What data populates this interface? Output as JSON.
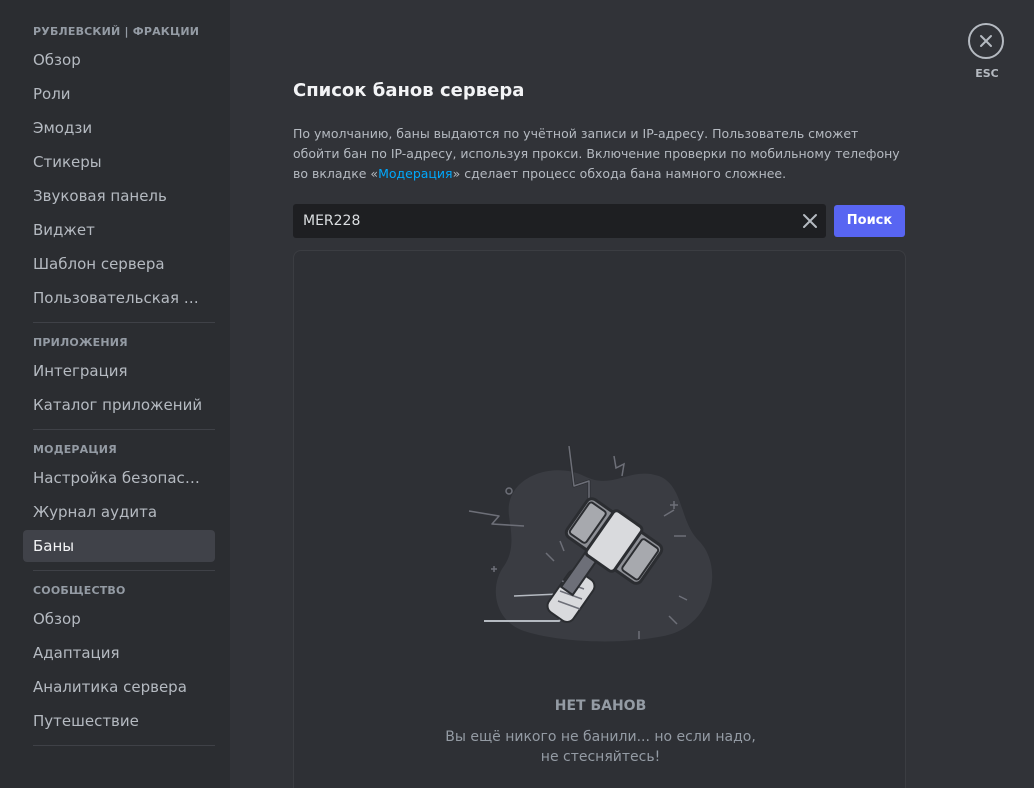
{
  "sidebar": {
    "sections": [
      {
        "title": "РУБЛЕВСКИЙ | ФРАКЦИИ",
        "items": [
          "Обзор",
          "Роли",
          "Эмодзи",
          "Стикеры",
          "Звуковая панель",
          "Виджет",
          "Шаблон сервера",
          "Пользовательская сс..."
        ]
      },
      {
        "title": "ПРИЛОЖЕНИЯ",
        "items": [
          "Интеграция",
          "Каталог приложений"
        ]
      },
      {
        "title": "МОДЕРАЦИЯ",
        "items": [
          "Настройка безопасно...",
          "Журнал аудита",
          "Баны"
        ]
      },
      {
        "title": "СООБЩЕСТВО",
        "items": [
          "Обзор",
          "Адаптация",
          "Аналитика сервера",
          "Путешествие"
        ]
      }
    ],
    "active_item": "Баны"
  },
  "main": {
    "title": "Список банов сервера",
    "description_before_link": "По умолчанию, баны выдаются по учётной записи и IP-адресу. Пользователь сможет обойти бан по IP-адресу, используя прокси. Включение проверки по мобильному телефону во вкладке «",
    "description_link": "Модерация",
    "description_after_link": "» сделает процесс обхода бана намного сложнее.",
    "search": {
      "value": "MER228",
      "button_label": "Поиск"
    },
    "empty_state": {
      "title": "НЕТ БАНОВ",
      "text_line1": "Вы ещё никого не банили... но если надо,",
      "text_line2": "не стесняйтесь!"
    }
  },
  "close": {
    "label": "ESC",
    "icon": "close-icon"
  },
  "colors": {
    "accent": "#5865f2",
    "link": "#00a8fc",
    "background": "#313338",
    "sidebar": "#2b2d31"
  }
}
